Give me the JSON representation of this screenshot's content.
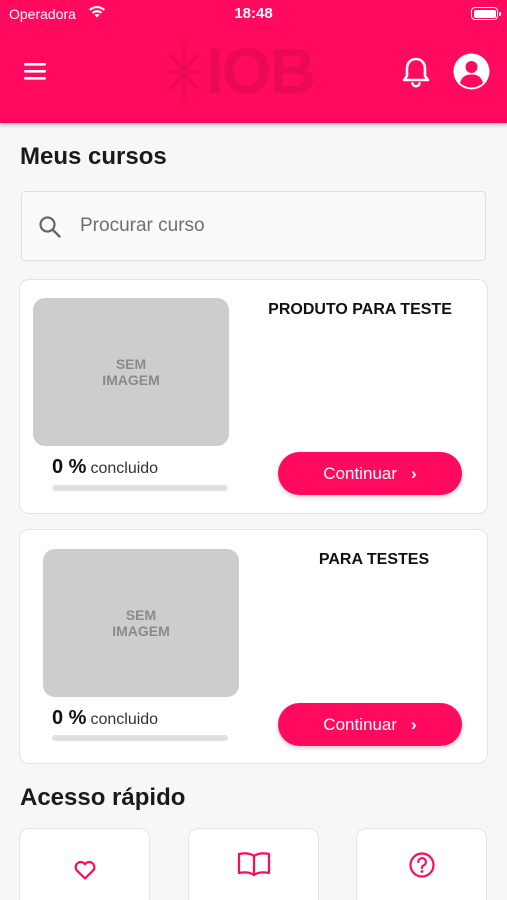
{
  "status_bar": {
    "carrier": "Operadora",
    "time": "18:48"
  },
  "header": {
    "logo_text": "IOB",
    "accent_color": "#ff0a5e"
  },
  "my_courses": {
    "title": "Meus cursos"
  },
  "search": {
    "placeholder": "Procurar curso"
  },
  "courses": [
    {
      "title": "PRODUTO PARA TESTE",
      "thumb_line1": "SEM",
      "thumb_line2": "IMAGEM",
      "percent": "0 %",
      "percent_label": "concluido",
      "progress": 0,
      "button": "Continuar"
    },
    {
      "title": "PARA TESTES",
      "thumb_line1": "SEM",
      "thumb_line2": "IMAGEM",
      "percent": "0 %",
      "percent_label": "concluido",
      "progress": 0,
      "button": "Continuar"
    }
  ],
  "quick_access": {
    "title": "Acesso rápido",
    "items": [
      {
        "icon": "heart-icon",
        "label": ""
      },
      {
        "icon": "book-icon",
        "label": ""
      },
      {
        "icon": "help-icon",
        "label": ""
      }
    ]
  }
}
